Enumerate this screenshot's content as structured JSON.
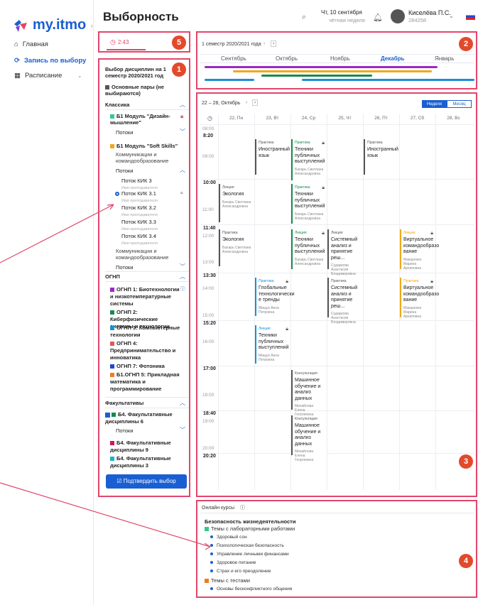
{
  "app": {
    "logo_text": "my.itmo",
    "page_title": "Выборность"
  },
  "nav": {
    "items": [
      {
        "label": "Главная",
        "icon": "home-icon"
      },
      {
        "label": "Запись по выбору",
        "icon": "refresh-icon"
      },
      {
        "label": "Расписание",
        "icon": "calendar-icon"
      }
    ]
  },
  "header": {
    "date_line1": "Чт, 10 сентября",
    "date_line2": "чётная неделя",
    "user_name": "Киселёва П.С.",
    "user_id": "284258"
  },
  "markers": [
    "1",
    "2",
    "3",
    "4",
    "5"
  ],
  "timer": {
    "value": "2:43"
  },
  "panel": {
    "title": "Выбор дисциплин на 1 семестр 2020/2021 год",
    "main_pairs": "Основные пары (не выбираются)",
    "section_classic": "Классика",
    "module1": "Б1 Модуль \"Дизайн-мышление\"",
    "streams": "Потоки",
    "module2": "Б1 Модуль \"Soft Skills\"",
    "comm1": "Коммуникации и командообразование",
    "streams2": "Потоки",
    "stream_items": [
      {
        "name": "Поток КИК 3",
        "teacher": "Имя преподавателя"
      },
      {
        "name": "Поток КИК 3.1",
        "teacher": "Имя преподавателя"
      },
      {
        "name": "Поток КИК 3.2",
        "teacher": "Имя преподавателя"
      },
      {
        "name": "Поток КИК 3.3",
        "teacher": "Имя преподавателя"
      },
      {
        "name": "Поток КИК 3.4",
        "teacher": "Имя преподавателя"
      }
    ],
    "comm2": "Коммуникации и командообразование",
    "streams3": "Потоки",
    "section_ognp": "ОГНП",
    "ognp_items": [
      {
        "name": "ОГНП 1: Биотехнологии и низкотемпературные системы",
        "color": "#9b27c8"
      },
      {
        "name": "ОГНП 2: Киберфизические системы и технологии",
        "color": "#168a4e"
      },
      {
        "name": "ОГНП 3: Компьютерные технологии",
        "color": "#1a8fd8"
      },
      {
        "name": "ОГНП 4: Предпринимательство и инноватика",
        "color": "#e25a5a"
      },
      {
        "name": "ОГНП 7: Фотоника",
        "color": "#1a4bd0"
      },
      {
        "name": "Б1.ОГНП 5: Прикладная математика и программирование",
        "color": "#f07c1b"
      }
    ],
    "section_fac": "Факультативы",
    "fac1": "Б4. Факультативные дисциплины 6",
    "streams4": "Потоки",
    "fac2": "Б4. Факультативные дисциплины 9",
    "fac3": "Б4. Факультативные дисциплины 3",
    "confirm": "Подтвердить выбор"
  },
  "timeline": {
    "semester": "1 семестр 2020/2021 года",
    "months": [
      "Сентябрь",
      "Октябрь",
      "Ноябрь",
      "Декабрь",
      "Январь"
    ]
  },
  "schedule": {
    "week": "22 – 28, Октябрь",
    "view_week": "Неделя",
    "view_month": "Месяц",
    "days": [
      "22, Пн",
      "23, Вт",
      "24, Ср",
      "25, Чт",
      "26, Пт",
      "27, Сб",
      "28, Вс"
    ],
    "times": [
      "08:00",
      "09:00",
      "11:00",
      "12:00",
      "13:00",
      "14:00",
      "15:00",
      "16:00",
      "18:00",
      "19:00",
      "20:00"
    ],
    "bold_times": [
      "8:20",
      "10:00",
      "11:40",
      "13:30",
      "15:20",
      "17:00",
      "18:40",
      "20:20"
    ],
    "cards": [
      {
        "type": "Практика",
        "title": "Иностранный язык",
        "who": ""
      },
      {
        "type": "Практика",
        "title": "Техники публичных выступлений",
        "who": "Бахарь Светлана Александровна"
      },
      {
        "type": "Практика",
        "title": "Иностранный язык",
        "who": ""
      },
      {
        "type": "Лекция",
        "title": "Экология",
        "who": "Бахарь Светлана Александровна"
      },
      {
        "type": "Практика",
        "title": "Техники публичных выступлений",
        "who": "Бахарь Светлана Александровна"
      },
      {
        "type": "Практика",
        "title": "Экология",
        "who": "Бахарь Светлана Александровна"
      },
      {
        "type": "Лекция",
        "title": "Техники публичных выступлений",
        "who": "Бахарь Светлана Александровна"
      },
      {
        "type": "Лекция",
        "title": "Системный анализ и принятие реш...",
        "who": "Сударкова Анастасия Владимировна"
      },
      {
        "type": "Лекция",
        "title": "Виртуальное командообразо вание",
        "who": "Макаренко Марина Архиповна"
      },
      {
        "type": "Практика",
        "title": "Глобальные технологически е тренды",
        "who": "Мищук Анна Петровна"
      },
      {
        "type": "Практика",
        "title": "Системный анализ и принятие реш...",
        "who": "Сударкова Анастасия Владимировна"
      },
      {
        "type": "Практика",
        "title": "Виртуальное командообразо вание",
        "who": "Макаренко Марина Архиповна"
      },
      {
        "type": "Лекция",
        "title": "Техники публичных выступлений",
        "who": "Мищук Анна Петровна"
      },
      {
        "type": "Консультация",
        "title": "Машинное обучение и анализ данных",
        "who": "Михайлова Елена Георгиевна"
      },
      {
        "type": "Консультация",
        "title": "Машинное обучение и анализ данных",
        "who": "Михайлова Елена Георгиевна"
      }
    ]
  },
  "online": {
    "label": "Онлайн курсы",
    "course": "Безопасность жизнедеятельности",
    "group1": "Темы с лабораторными работами",
    "group1_items": [
      "Здоровый сон",
      "Психологическая безопасность",
      "Управление личными финансами",
      "Здоровое питание",
      "Страх и его преодоление"
    ],
    "group2": "Темы с тестами",
    "group2_items": [
      "Основы бесконфликтного общения"
    ]
  },
  "colors": {
    "accent": "#1a5fd1",
    "marker": "#e24a2b",
    "box": "#e2466b"
  }
}
